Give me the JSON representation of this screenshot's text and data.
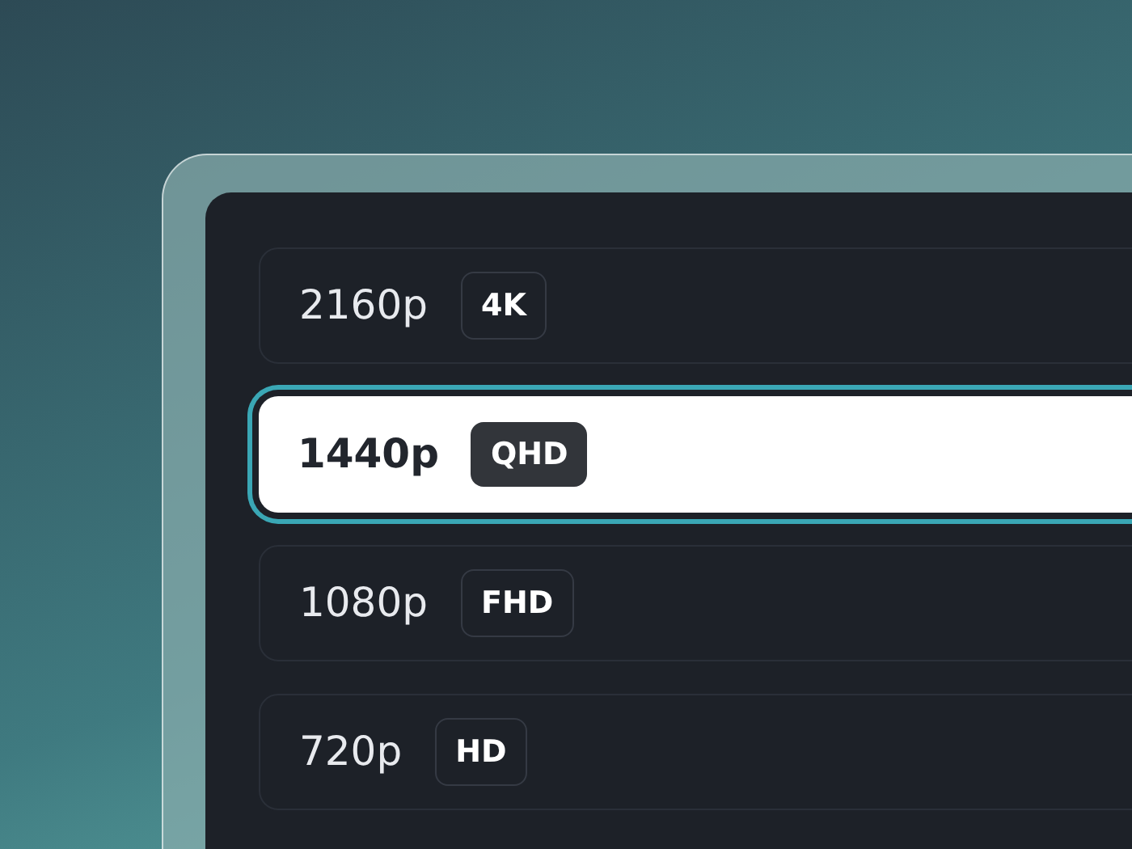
{
  "resolutions": [
    {
      "label": "2160p",
      "badge": "4K",
      "selected": false
    },
    {
      "label": "1440p",
      "badge": "QHD",
      "selected": true
    },
    {
      "label": "1080p",
      "badge": "FHD",
      "selected": false
    },
    {
      "label": "720p",
      "badge": "HD",
      "selected": false
    }
  ]
}
